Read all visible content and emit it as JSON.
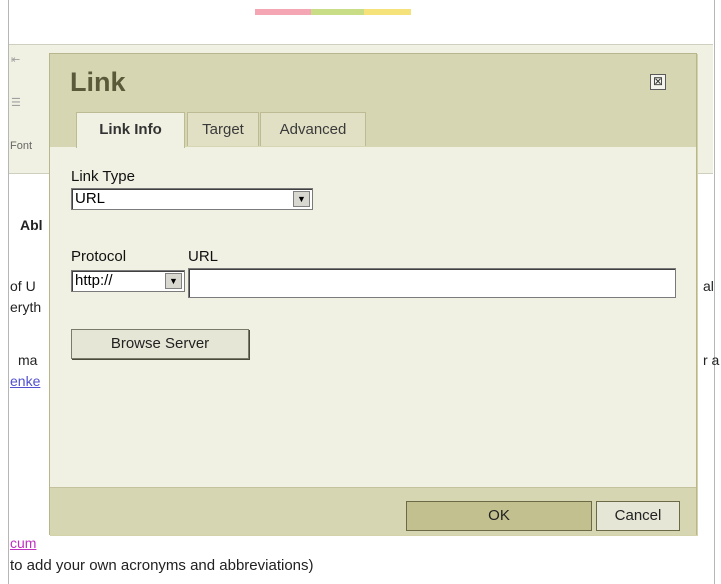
{
  "background": {
    "font_label": "Font",
    "heading_fragment": "Abl",
    "line1_left": "of U",
    "line1_right": "al",
    "line2_left": "eryth",
    "line3_left": "ma",
    "line3_right": "r a",
    "link1_fragment": "enke",
    "link2_fragment": "cum",
    "bottom_text": "to add your own acronyms and abbreviations)"
  },
  "dialog": {
    "title": "Link",
    "close_glyph": "⊠",
    "tabs": [
      {
        "label": "Link Info",
        "active": true
      },
      {
        "label": "Target",
        "active": false
      },
      {
        "label": "Advanced",
        "active": false
      }
    ],
    "link_type": {
      "label": "Link Type",
      "value": "URL"
    },
    "protocol": {
      "label": "Protocol",
      "value": "http://"
    },
    "url": {
      "label": "URL",
      "value": ""
    },
    "browse_button": "Browse Server",
    "ok_button": "OK",
    "cancel_button": "Cancel"
  }
}
